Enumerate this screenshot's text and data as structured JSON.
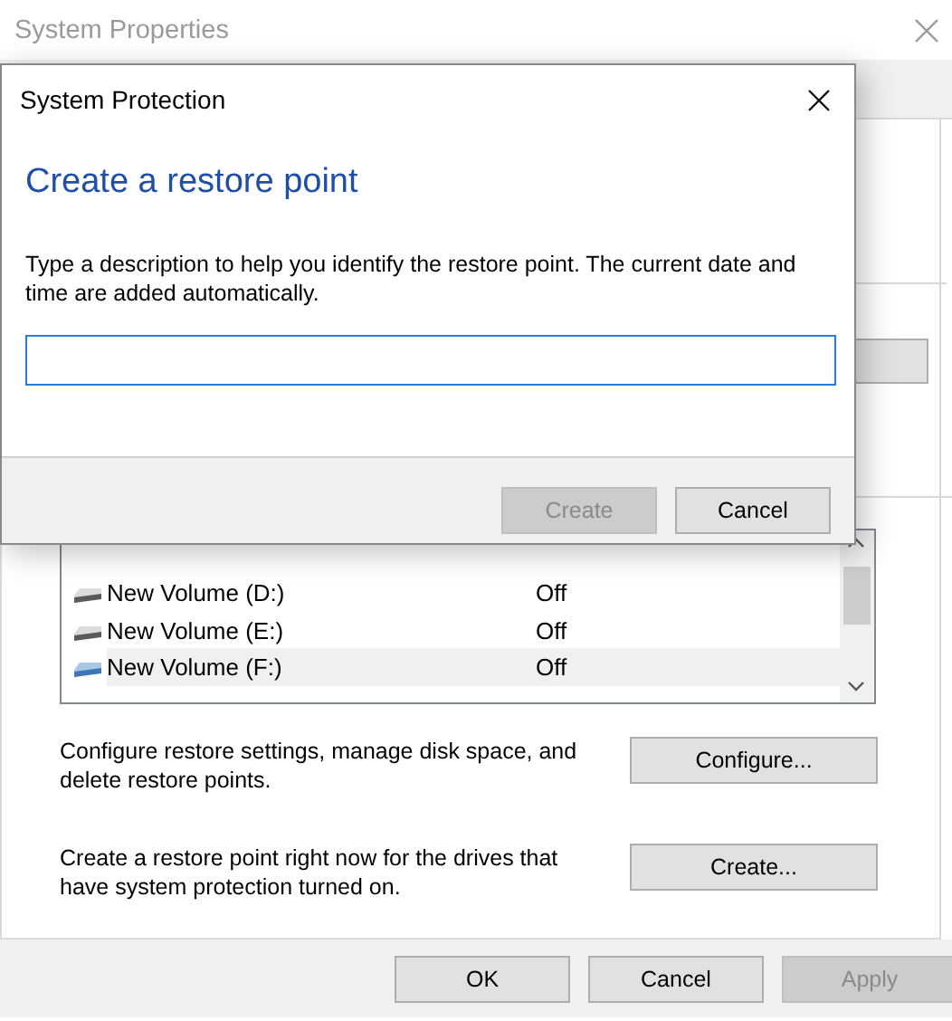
{
  "system_properties": {
    "title": "System Properties",
    "drives": [
      {
        "name": "New Volume (D:)",
        "protection": "Off",
        "selected": false,
        "kind": "hdd"
      },
      {
        "name": "New Volume (E:)",
        "protection": "Off",
        "selected": false,
        "kind": "hdd"
      },
      {
        "name": "New Volume (F:)",
        "protection": "Off",
        "selected": true,
        "kind": "external"
      }
    ],
    "configure_text": "Configure restore settings, manage disk space, and delete restore points.",
    "configure_button": {
      "label": "Configure...",
      "disabled": false
    },
    "create_text": "Create a restore point right now for the drives that have system protection turned on.",
    "create_button": {
      "label": "Create...",
      "disabled": false
    },
    "buttons": [
      {
        "label": "OK",
        "disabled": false
      },
      {
        "label": "Cancel",
        "disabled": false
      },
      {
        "label": "Apply",
        "disabled": true
      }
    ]
  },
  "system_protection_dialog": {
    "title": "System Protection",
    "heading": "Create a restore point",
    "description": "Type a description to help you identify the restore point. The current date and time are added automatically.",
    "buttons": [
      {
        "label": "Create",
        "disabled": true
      },
      {
        "label": "Cancel",
        "disabled": false
      }
    ]
  }
}
